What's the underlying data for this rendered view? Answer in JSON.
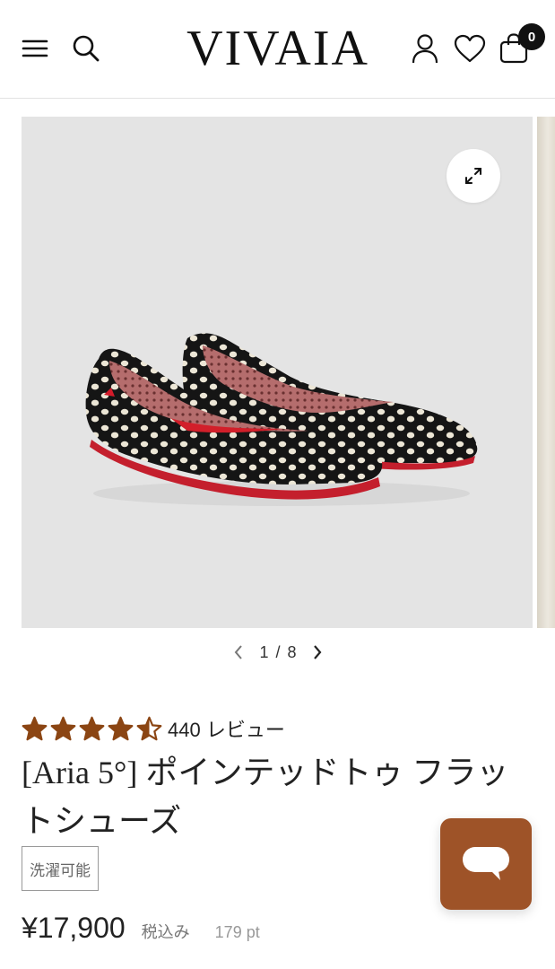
{
  "header": {
    "logo": "VIVAIA",
    "cart_count": "0",
    "icons": [
      "menu-icon",
      "search-icon",
      "account-icon",
      "heart-icon",
      "shopping-bag-icon"
    ]
  },
  "gallery": {
    "pager_current": "1",
    "pager_separator": "/",
    "pager_total": "8",
    "zoom_icon": "expand-arrows-icon"
  },
  "product": {
    "rating": 4.5,
    "rating_max": 5,
    "review_text": "440 レビュー",
    "title": "[Aria 5°] ポインテッドトゥ フラットシューズ",
    "badge": "洗濯可能",
    "price": "¥17,900",
    "tax_label": "税込み",
    "points": "179 pt"
  },
  "colors": {
    "accent": "#8b4513",
    "chat_button": "#9e5328",
    "star": "#8b4513"
  },
  "chat": {
    "icon": "chat-bubble-icon"
  }
}
